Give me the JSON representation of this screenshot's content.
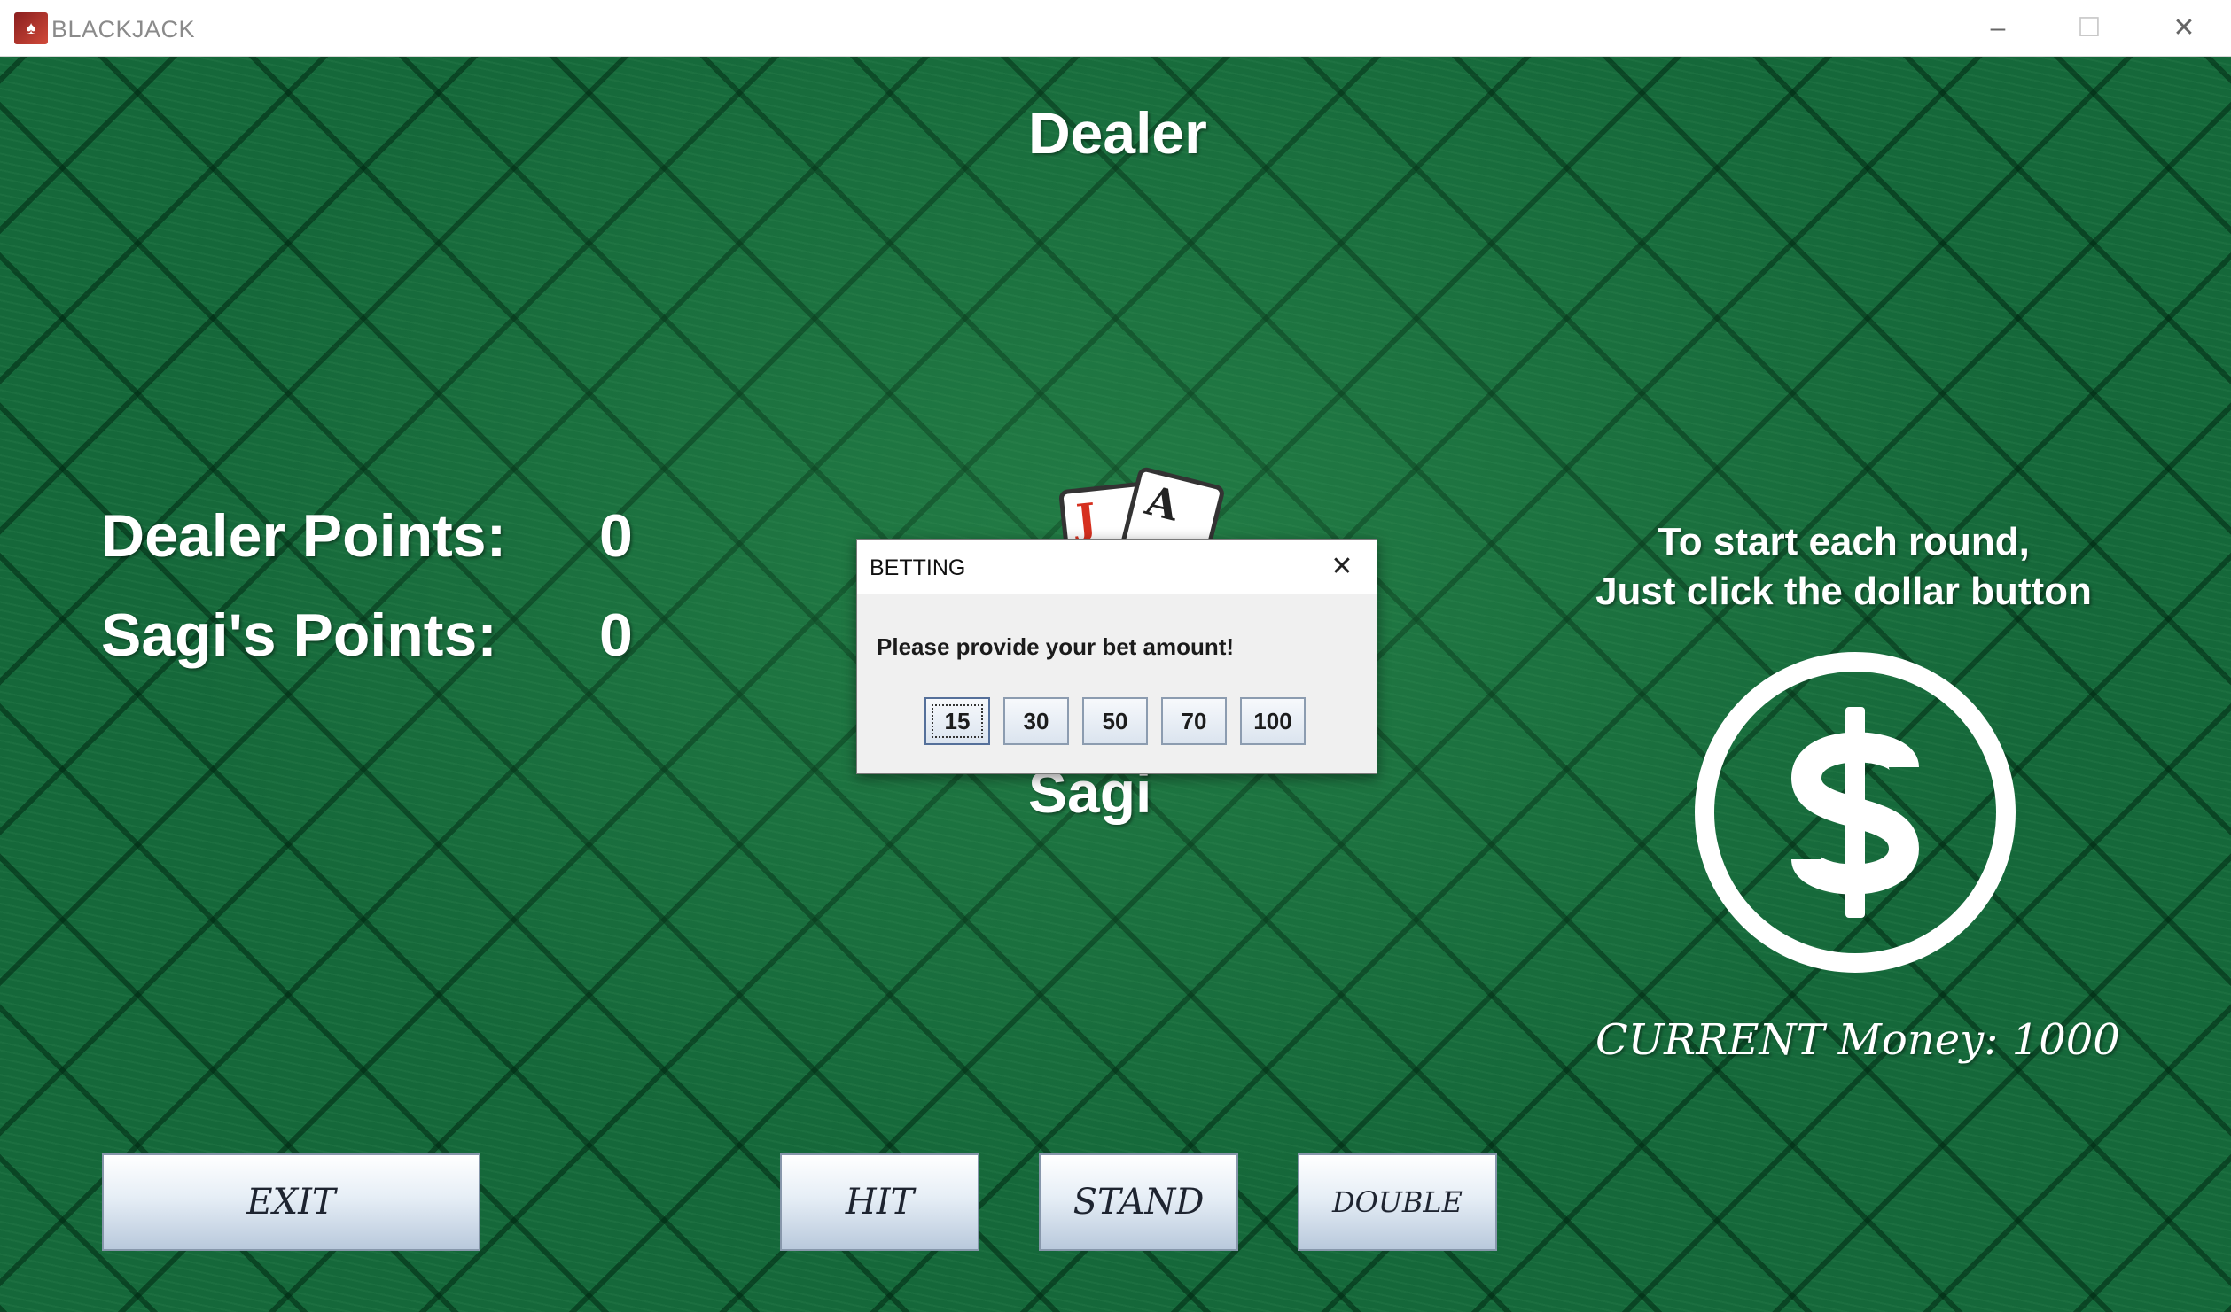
{
  "window": {
    "title": "BLACKJACK",
    "minimize_glyph": "–",
    "maximize_glyph": "☐",
    "close_glyph": "✕"
  },
  "table": {
    "dealer_heading": "Dealer",
    "player_heading": "Sagi",
    "dealer_points_label": "Dealer Points:",
    "dealer_points_value": "0",
    "player_points_label": "Sagi's Points:",
    "player_points_value": "0",
    "cards": [
      {
        "rank": "J",
        "color": "#d6301f"
      },
      {
        "rank": "A",
        "color": "#222222"
      }
    ]
  },
  "hint": {
    "line1": "To start each round,",
    "line2": "Just click the dollar button"
  },
  "dollar_button": {
    "icon": "dollar-icon"
  },
  "money": {
    "text": "CURRENT Money: 1000"
  },
  "buttons": {
    "exit": "EXIT",
    "hit": "HIT",
    "stand": "STAND",
    "double": "DOUBLE"
  },
  "dialog": {
    "title": "BETTING",
    "close_glyph": "✕",
    "message": "Please provide your bet amount!",
    "bets": [
      "15",
      "30",
      "50",
      "70",
      "100"
    ],
    "selected_bet": "15"
  },
  "colors": {
    "felt": "#15683a",
    "text": "#ffffff",
    "card_red": "#d6301f"
  }
}
